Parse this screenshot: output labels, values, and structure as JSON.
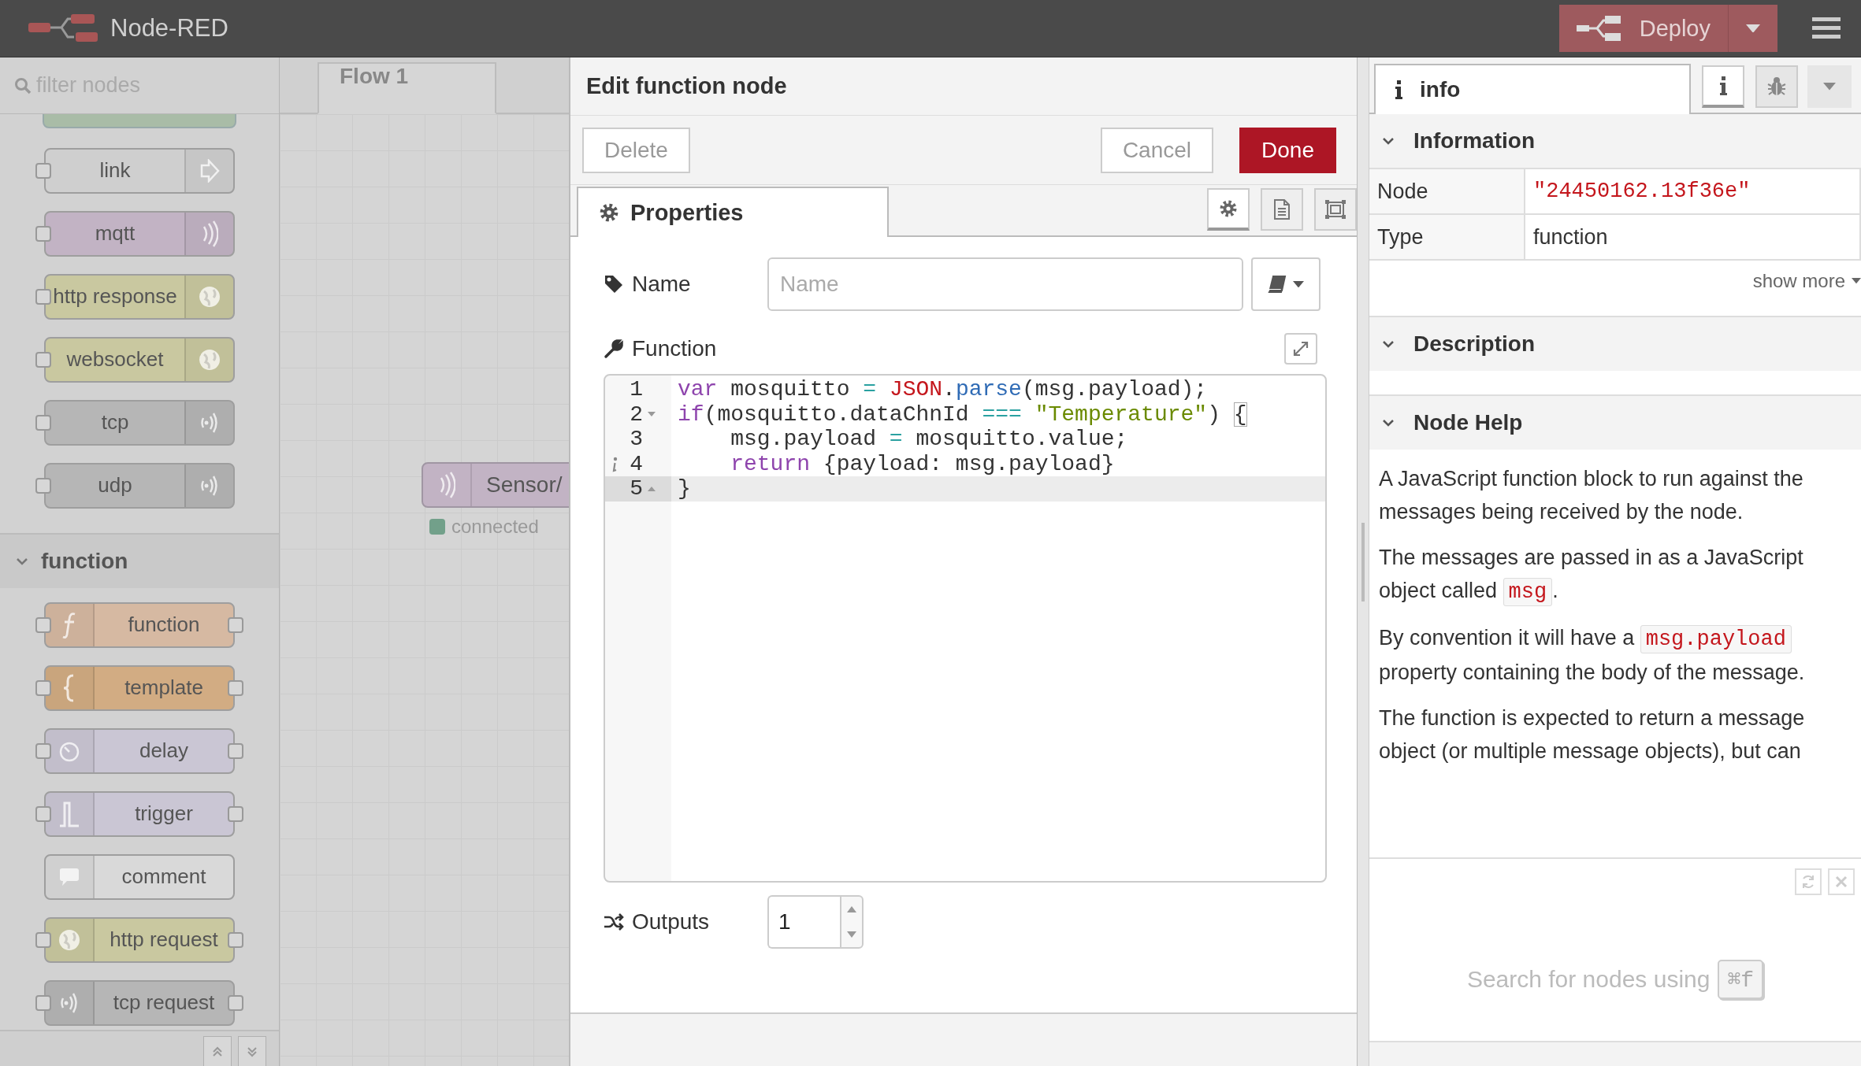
{
  "header": {
    "title": "Node-RED",
    "deploy": {
      "label": "Deploy"
    }
  },
  "palette": {
    "filter": {
      "placeholder": "filter nodes"
    },
    "nodes": [
      {
        "label": "link",
        "kind": "link",
        "color": "#cfcfcf",
        "input": true,
        "output": false
      },
      {
        "label": "mqtt",
        "kind": "wave",
        "color": "#c2b3c4",
        "input": true,
        "output": false
      },
      {
        "label": "http response",
        "kind": "globe",
        "color": "#c9c8a0",
        "input": true,
        "output": false
      },
      {
        "label": "websocket",
        "kind": "globe",
        "color": "#c9c8a0",
        "input": true,
        "output": false
      },
      {
        "label": "tcp",
        "kind": "signal",
        "color": "#b6b6b6",
        "input": true,
        "output": false
      },
      {
        "label": "udp",
        "kind": "signal",
        "color": "#b6b6b6",
        "input": true,
        "output": false
      }
    ],
    "categories": [
      {
        "label": "function",
        "expanded": true,
        "nodes": [
          {
            "label": "function",
            "kind": "function",
            "color": "#d6b9a2",
            "input": true,
            "output": true
          },
          {
            "label": "template",
            "kind": "template",
            "color": "#d2ac83",
            "input": true,
            "output": true
          },
          {
            "label": "delay",
            "kind": "timer",
            "color": "#cac6d4",
            "input": true,
            "output": true
          },
          {
            "label": "trigger",
            "kind": "pulse",
            "color": "#cac6d4",
            "input": true,
            "output": true
          },
          {
            "label": "comment",
            "kind": "comment",
            "color": "#d9d9d9",
            "input": false,
            "output": false
          },
          {
            "label": "http request",
            "kind": "globe",
            "color": "#c9c8a0",
            "input": true,
            "output": true
          },
          {
            "label": "tcp request",
            "kind": "signal",
            "color": "#b6b6b6",
            "input": true,
            "output": true
          }
        ]
      }
    ]
  },
  "canvas": {
    "tabs": [
      {
        "label": "Flow 1",
        "selected": true
      }
    ],
    "nodes": [
      {
        "label": "Sensor/",
        "kind": "wave",
        "color": "#c2b3c4",
        "status": {
          "text": "connected",
          "color": "#72a08a"
        }
      }
    ]
  },
  "editor": {
    "title": "Edit function node",
    "buttons": [
      {
        "label": "Delete",
        "kind": "plain"
      },
      {
        "label": "Cancel",
        "kind": "plain"
      },
      {
        "label": "Done",
        "kind": "primary"
      }
    ],
    "tabs": [
      {
        "label": "Properties",
        "selected": true
      }
    ],
    "tab_buttons": [
      {
        "kind": "gear",
        "selected": true
      },
      {
        "kind": "document",
        "selected": false
      },
      {
        "kind": "frame",
        "selected": false
      }
    ],
    "name": {
      "label": "Name",
      "placeholder": "Name"
    },
    "function": {
      "label": "Function",
      "lines": [
        {
          "number": "1",
          "active": false,
          "fold_start": false,
          "fold_end": false,
          "hint": false,
          "tokens": [
            {
              "text": "var",
              "kind": "keyword"
            },
            {
              "text": " mosquitto ",
              "kind": "plain"
            },
            {
              "text": "= ",
              "kind": "operator"
            },
            {
              "text": "JSON",
              "kind": "builtin"
            },
            {
              "text": ".",
              "kind": "plain"
            },
            {
              "text": "parse",
              "kind": "property"
            },
            {
              "text": "(msg.payload);",
              "kind": "plain"
            }
          ]
        },
        {
          "number": "2",
          "fold_start": true,
          "fold_end": false,
          "hint": false,
          "active": false,
          "tokens": [
            {
              "text": "if",
              "kind": "keyword"
            },
            {
              "text": "(mosquitto.dataChnId ",
              "kind": "plain"
            },
            {
              "text": "=== ",
              "kind": "operator"
            },
            {
              "text": "\"Temperature\"",
              "kind": "string"
            },
            {
              "text": ") ",
              "kind": "plain"
            },
            {
              "text": "{",
              "kind": "matched-bracket"
            }
          ]
        },
        {
          "number": "3",
          "active": false,
          "fold_start": false,
          "fold_end": false,
          "hint": false,
          "tokens": [
            {
              "text": "    msg.payload ",
              "kind": "plain"
            },
            {
              "text": "=",
              "kind": "operator"
            },
            {
              "text": " mosquitto.value;",
              "kind": "plain"
            }
          ]
        },
        {
          "number": "4",
          "hint": true,
          "fold_start": false,
          "fold_end": false,
          "active": false,
          "tokens": [
            {
              "text": "    return",
              "kind": "keyword"
            },
            {
              "text": " {payload: msg.payload}",
              "kind": "plain"
            }
          ]
        },
        {
          "number": "5",
          "fold_start": false,
          "fold_end": true,
          "hint": false,
          "active": true,
          "tokens": [
            {
              "text": "}",
              "kind": "plain"
            }
          ]
        }
      ]
    },
    "outputs": {
      "label": "Outputs",
      "value": "1"
    }
  },
  "sidebar": {
    "tabs": [
      {
        "label": "info",
        "selected": true
      }
    ],
    "tab_buttons": [
      {
        "kind": "info",
        "selected": true
      },
      {
        "kind": "debug",
        "selected": false
      }
    ],
    "sections": [
      {
        "title": "Information",
        "expanded": true,
        "kind": "table",
        "rows": [
          {
            "key": "Node",
            "value": "\"24450162.13f36e\"",
            "kind": "id"
          },
          {
            "key": "Type",
            "value": "function",
            "kind": "text"
          }
        ],
        "show_more": "show more"
      },
      {
        "title": "Description",
        "expanded": true,
        "kind": "text"
      },
      {
        "title": "Node Help",
        "expanded": true,
        "kind": "help",
        "paragraphs": [
          [
            {
              "text": "A JavaScript function block to run against the messages being received by the node.",
              "kind": "text"
            }
          ],
          [
            {
              "text": "The messages are passed in as a JavaScript object called ",
              "kind": "text"
            },
            {
              "text": "msg",
              "kind": "code"
            },
            {
              "text": ".",
              "kind": "text"
            }
          ],
          [
            {
              "text": "By convention it will have a ",
              "kind": "text"
            },
            {
              "text": "msg.payload",
              "kind": "code"
            },
            {
              "text": " property containing the body of the message.",
              "kind": "text"
            }
          ],
          [
            {
              "text": "The function is expected to return a message object (or multiple message objects), but can",
              "kind": "text"
            }
          ]
        ]
      }
    ],
    "search_hint": {
      "text": "Search for nodes using",
      "shortcut": "⌘f"
    }
  }
}
